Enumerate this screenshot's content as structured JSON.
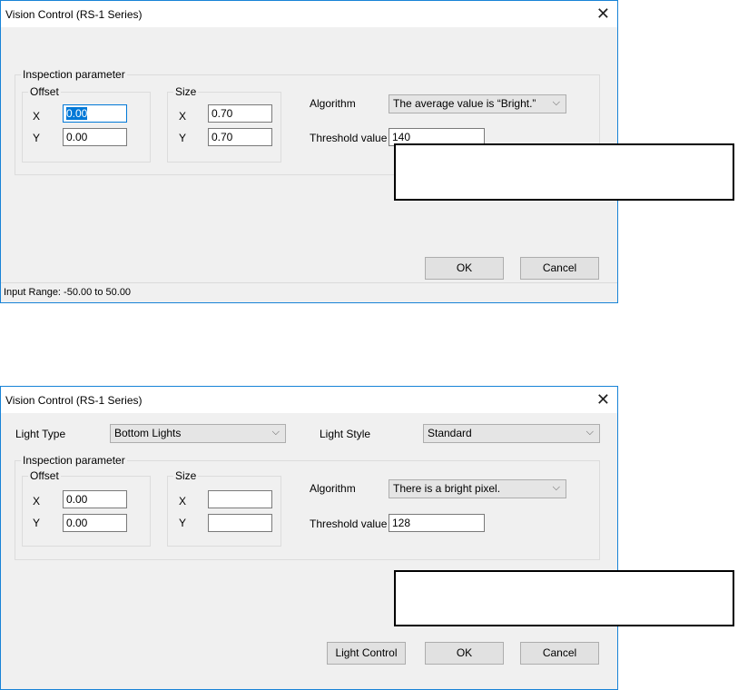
{
  "dialog1": {
    "title": "Vision Control (RS-1 Series)",
    "inspection_group": "Inspection parameter",
    "offset_group": "Offset",
    "size_group": "Size",
    "x_label": "X",
    "y_label": "Y",
    "offset_x": "0.00",
    "offset_y": "0.00",
    "size_x": "0.70",
    "size_y": "0.70",
    "algorithm_label": "Algorithm",
    "algorithm_value": "The average value is “Bright.”",
    "threshold_label": "Threshold value",
    "threshold_value": "140",
    "ok": "OK",
    "cancel": "Cancel",
    "status": "Input Range: -50.00 to 50.00"
  },
  "dialog2": {
    "title": "Vision Control (RS-1 Series)",
    "light_type_label": "Light Type",
    "light_type_value": "Bottom Lights",
    "light_style_label": "Light Style",
    "light_style_value": "Standard",
    "inspection_group": "Inspection parameter",
    "offset_group": "Offset",
    "size_group": "Size",
    "x_label": "X",
    "y_label": "Y",
    "offset_x": "0.00",
    "offset_y": "0.00",
    "size_x": "",
    "size_y": "",
    "algorithm_label": "Algorithm",
    "algorithm_value": "There is a bright pixel.",
    "threshold_label": "Threshold value",
    "threshold_value": "128",
    "light_control": "Light Control",
    "ok": "OK",
    "cancel": "Cancel"
  }
}
